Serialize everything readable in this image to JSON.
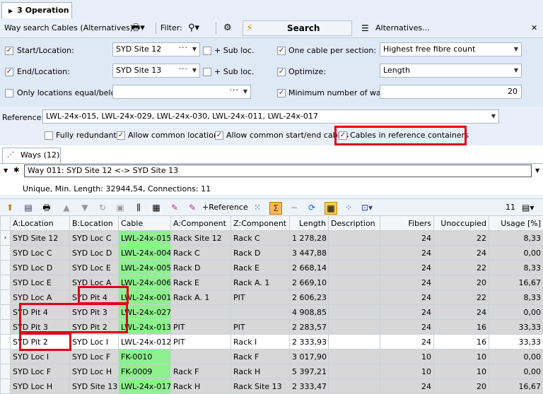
{
  "tab": {
    "title": "3 Operation"
  },
  "toolbar": {
    "title": "Way search Cables (Alternatives)",
    "filter_label": "Filter:",
    "search_label": "Search",
    "alternatives_label": "Alternatives...",
    "close": "✕"
  },
  "form": {
    "start_label": "Start/Location:",
    "start_value": "SYD Site 12",
    "end_label": "End/Location:",
    "end_value": "SYD Site 13",
    "sub_loc_label": "+ Sub loc.",
    "only_label": "Only locations equal/below:",
    "one_cable_label": "One cable per section:",
    "one_cable_value": "Highest free fibre count",
    "optimize_label": "Optimize:",
    "optimize_value": "Length",
    "min_ways_label": "Minimum number of ways:",
    "min_ways_value": "20",
    "reference_label": "Reference:",
    "reference_value": "LWL-24x-015, LWL-24x-029, LWL-24x-030, LWL-24x-011, LWL-24x-017",
    "fully_redundant_label": "Fully redundant",
    "allow_common_loc_label": "Allow common locations",
    "allow_common_startend_label": "Allow common start/end cables",
    "cables_ref_label": "Cables in reference containers"
  },
  "ways": {
    "tab_label": "Ways (12)",
    "selected_way": "Way 011: SYD Site 12 <-> SYD Site 13",
    "summary": "Unique, Min. Length: 32944,54, Connections: 11"
  },
  "grid_toolbar": {
    "reference_label": "+Reference",
    "count": "11"
  },
  "table": {
    "columns": [
      "A:Location",
      "B:Location",
      "Cable",
      "A:Component",
      "Z:Component",
      "Length",
      "Description",
      "Fibers",
      "Unoccupied",
      "Usage [%]"
    ],
    "rows": [
      [
        "SYD Site 12",
        "SYD Loc C",
        "LWL-24x-015",
        "Rack Site 12",
        "Rack C",
        "1 278,28",
        "",
        "24",
        "22",
        "8,33"
      ],
      [
        "SYD Loc C",
        "SYD Loc D",
        "LWL-24x-004",
        "Rack C",
        "Rack D",
        "3 447,88",
        "",
        "24",
        "24",
        "0,00"
      ],
      [
        "SYD Loc D",
        "SYD Loc E",
        "LWL-24x-005",
        "Rack D",
        "Rack E",
        "2 668,14",
        "",
        "24",
        "22",
        "8,33"
      ],
      [
        "SYD Loc E",
        "SYD Loc A",
        "LWL-24x-006",
        "Rack E",
        "Rack A. 1",
        "2 669,10",
        "",
        "24",
        "20",
        "16,67"
      ],
      [
        "SYD Loc A",
        "SYD Pit 4",
        "LWL-24x-001",
        "Rack A. 1",
        "PIT",
        "2 606,23",
        "",
        "24",
        "22",
        "8,33"
      ],
      [
        "SYD Pit 4",
        "SYD Pit 3",
        "LWL-24x-027",
        "",
        "",
        "4 908,85",
        "",
        "24",
        "24",
        "0,00"
      ],
      [
        "SYD Pit 3",
        "SYD Pit 2",
        "LWL-24x-013",
        "PIT",
        "PIT",
        "2 283,57",
        "",
        "24",
        "16",
        "33,33"
      ],
      [
        "SYD Pit 2",
        "SYD Loc I",
        "LWL-24x-012",
        "PIT",
        "Rack I",
        "2 333,93",
        "",
        "24",
        "16",
        "33,33"
      ],
      [
        "SYD Loc I",
        "SYD Loc F",
        "FK-0010",
        "",
        "Rack F",
        "3 017,90",
        "",
        "10",
        "10",
        "0,00"
      ],
      [
        "SYD Loc F",
        "SYD Loc H",
        "FK-0009",
        "Rack F",
        "Rack H",
        "5 397,21",
        "",
        "10",
        "10",
        "0,00"
      ],
      [
        "SYD Loc H",
        "SYD Site 13",
        "LWL-24x-017",
        "Rack H",
        "Rack Site 13",
        "2 333,47",
        "",
        "24",
        "20",
        "16,67"
      ]
    ]
  },
  "colors": {
    "cable_highlight": "#8ef08e",
    "row_gray": "#d7d7d7",
    "red_box": "#e0001a"
  }
}
